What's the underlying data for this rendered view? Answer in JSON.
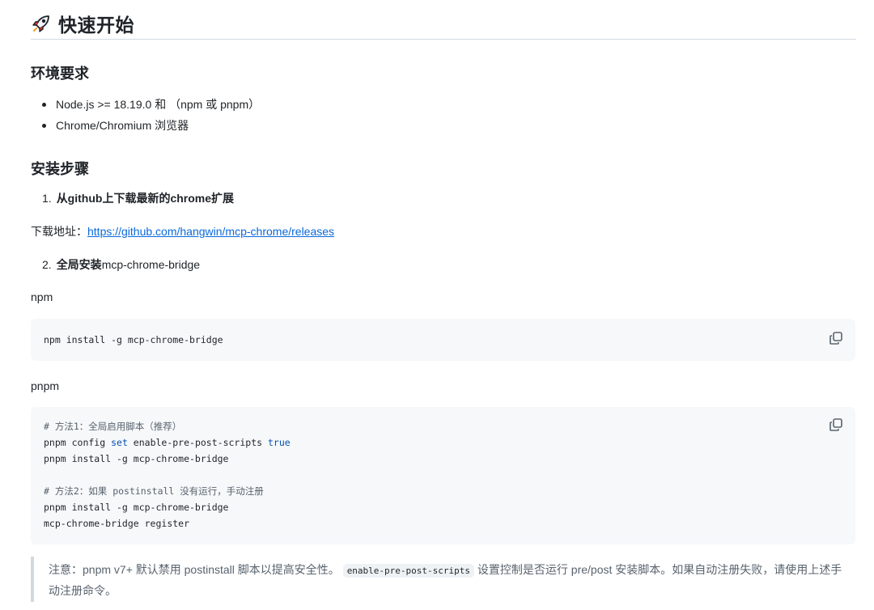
{
  "section": {
    "title": "快速开始",
    "icon": "rocket-icon"
  },
  "env": {
    "heading": "环境要求",
    "items": [
      "Node.js >= 18.19.0 和 （npm 或 pnpm）",
      "Chrome/Chromium 浏览器"
    ]
  },
  "install": {
    "heading": "安装步骤",
    "step1": {
      "num": "1.",
      "text": "从github上下载最新的chrome扩展"
    },
    "download_label": "下载地址：",
    "download_link": "https://github.com/hangwin/mcp-chrome/releases",
    "step2": {
      "num": "2.",
      "bold": "全局安装",
      "rest": "mcp-chrome-bridge"
    }
  },
  "npm": {
    "label": "npm",
    "code": "npm install -g mcp-chrome-bridge"
  },
  "pnpm": {
    "label": "pnpm",
    "comment1": "# 方法1：全局启用脚本（推荐）",
    "line2_cmd": "pnpm config ",
    "line2_set": "set",
    "line2_mid": " enable-pre-post-scripts ",
    "line2_true": "true",
    "line3": "pnpm install -g mcp-chrome-bridge",
    "comment2": "# 方法2：如果 postinstall 没有运行，手动注册",
    "line5": "pnpm install -g mcp-chrome-bridge",
    "line6": "mcp-chrome-bridge register"
  },
  "note": {
    "before": "注意：pnpm v7+ 默认禁用 postinstall 脚本以提高安全性。",
    "code": "enable-pre-post-scripts",
    "after": " 设置控制是否运行 pre/post 安装脚本。如果自动注册失败，请使用上述手动注册命令。"
  },
  "colors": {
    "link": "#0969da",
    "code_bg": "#f6f8fa",
    "keyword": "#0550ae",
    "muted": "#59636e"
  }
}
